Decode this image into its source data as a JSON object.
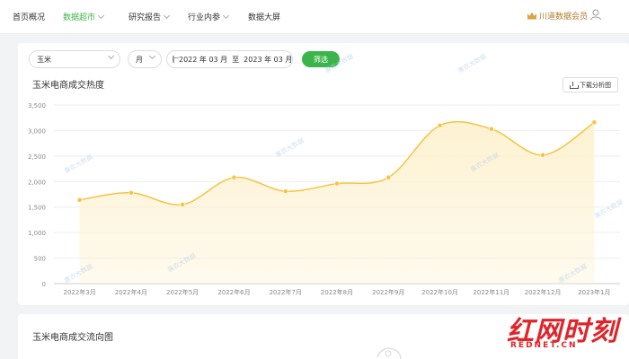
{
  "nav": {
    "items": [
      {
        "label": "首页概况",
        "active": false,
        "dropdown": false
      },
      {
        "label": "数据超市",
        "active": true,
        "dropdown": true
      },
      {
        "label": "研究报告",
        "active": false,
        "dropdown": true
      },
      {
        "label": "行业内参",
        "active": false,
        "dropdown": true
      },
      {
        "label": "数据大屏",
        "active": false,
        "dropdown": false
      }
    ],
    "member_label": "川道数据会员"
  },
  "filters": {
    "product": "玉米",
    "period": "月",
    "date_start": "2022 年 03 月",
    "date_sep": "至",
    "date_end": "2023 年 03 月",
    "filter_button": "筛选"
  },
  "chart_section": {
    "title": "玉米电商成交热度",
    "download_label": "下载分析图"
  },
  "chart_data": {
    "type": "area",
    "categories": [
      "2022年3月",
      "2022年4月",
      "2022年5月",
      "2022年6月",
      "2022年7月",
      "2022年8月",
      "2022年9月",
      "2022年10月",
      "2022年11月",
      "2022年12月",
      "2023年1月"
    ],
    "values": [
      1640,
      1780,
      1550,
      2080,
      1810,
      1960,
      2080,
      3100,
      3030,
      2520,
      3160
    ],
    "ylim": [
      0,
      3500
    ],
    "yticks": [
      "0",
      "500",
      "1,000",
      "1,500",
      "2,000",
      "2,500",
      "3,000",
      "3,500"
    ],
    "line_color": "#f6c443",
    "fill_color": "#fdf1cf",
    "grid": true
  },
  "watermark": "惠农大数据",
  "flow_section": {
    "title": "玉米电商成交流向图"
  },
  "logo": {
    "main": "红网时刻",
    "sub": "REDNET.CN"
  },
  "colors": {
    "accent": "#3bb54a",
    "member": "#b07a2b"
  }
}
